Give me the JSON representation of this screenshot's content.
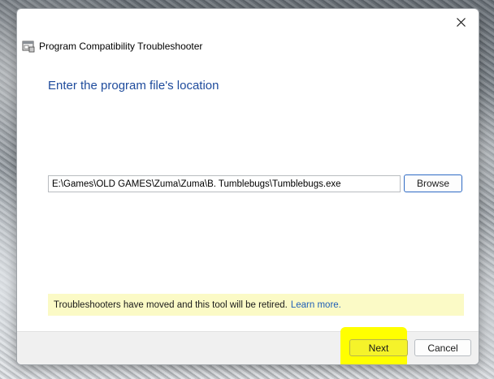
{
  "window": {
    "title": "Program Compatibility Troubleshooter",
    "close_icon": "close-icon",
    "app_icon": "troubleshooter-app-icon"
  },
  "main": {
    "heading": "Enter the program file's location",
    "path_value": "E:\\Games\\OLD GAMES\\Zuma\\Zuma\\B. Tumblebugs\\Tumblebugs.exe",
    "browse_label": "Browse"
  },
  "notice": {
    "message": "Troubleshooters have moved and this tool will be retired.",
    "link_label": "Learn more.",
    "background_color": "#fbfac6",
    "link_color": "#1f5fb8"
  },
  "footer": {
    "next_label": "Next",
    "cancel_label": "Cancel",
    "highlight_color": "#ffff00"
  },
  "colors": {
    "heading": "#1e4b9c"
  }
}
